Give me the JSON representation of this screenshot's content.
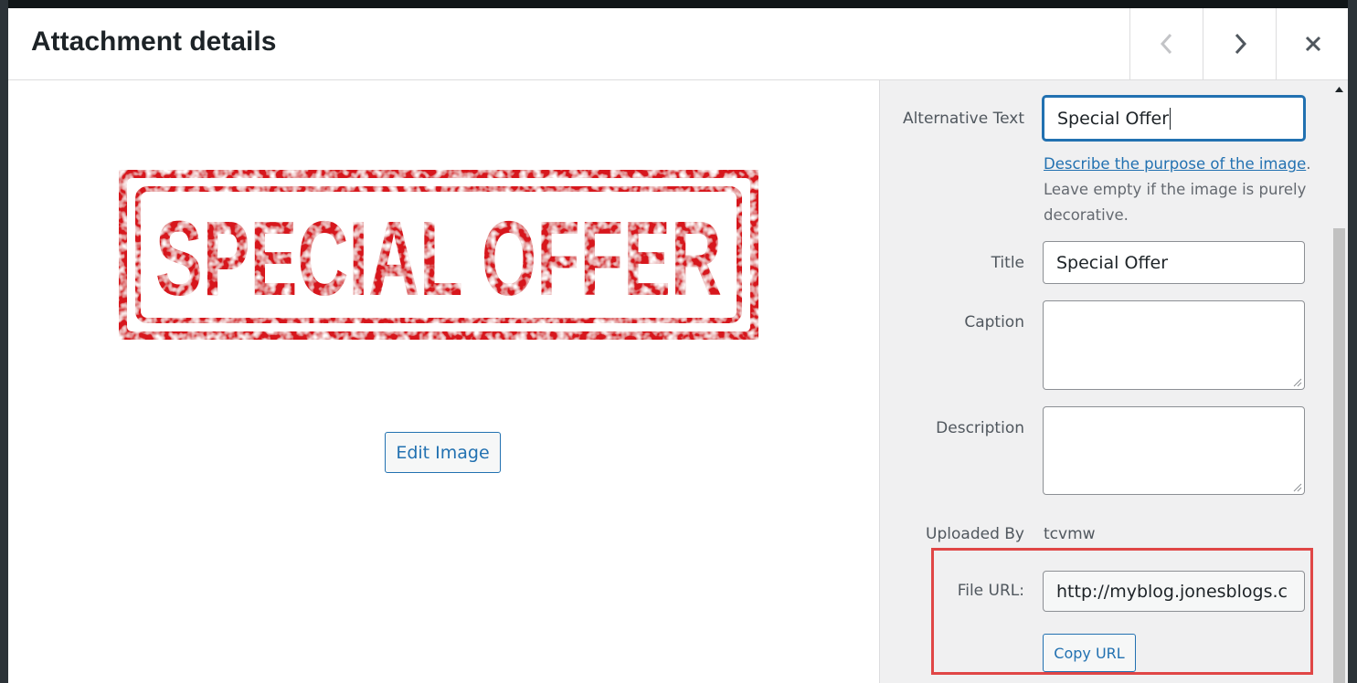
{
  "modal": {
    "title": "Attachment details",
    "prev_icon": "chevron-left-icon",
    "next_icon": "chevron-right-icon",
    "close_icon": "close-icon"
  },
  "preview": {
    "image_text": "SPECIAL OFFER",
    "image_color": "#d7191f",
    "edit_button": "Edit Image"
  },
  "sidebar": {
    "alt_text": {
      "label": "Alternative Text",
      "value": "Special Offer",
      "help_link": "Describe the purpose of the image",
      "help_rest": ". Leave empty if the image is purely decorative."
    },
    "title": {
      "label": "Title",
      "value": "Special Offer"
    },
    "caption": {
      "label": "Caption",
      "value": ""
    },
    "description": {
      "label": "Description",
      "value": ""
    },
    "uploaded_by": {
      "label": "Uploaded By",
      "value": "tcvmw"
    },
    "file_url": {
      "label": "File URL:",
      "value": "http://myblog.jonesblogs.c"
    },
    "copy_button": "Copy URL"
  },
  "colors": {
    "accent": "#2271b1",
    "highlight": "#e04646",
    "sidebar_bg": "#f0f0f1"
  }
}
